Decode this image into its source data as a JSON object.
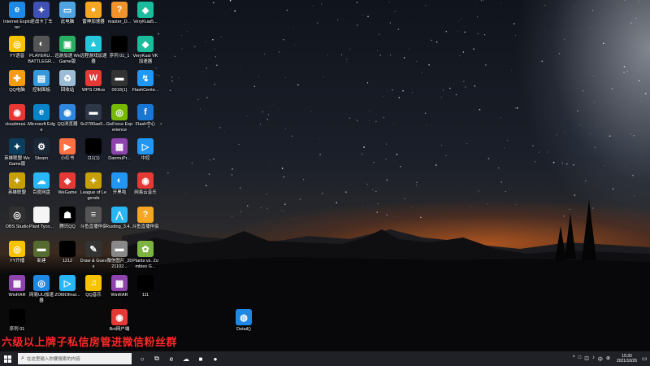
{
  "overlay_text": "六级以上牌子私信房管进微信粉丝群",
  "desktop_icons": [
    {
      "label": "Internet Explorer",
      "icon": "internet-explorer-icon",
      "color": "#1e88e5",
      "glyph": "e"
    },
    {
      "label": "逆战卡丁车",
      "icon": "game-icon",
      "color": "#3f51b5",
      "glyph": "✦"
    },
    {
      "label": "此电脑",
      "icon": "computer-icon",
      "color": "#4fa3e0",
      "glyph": "▭"
    },
    {
      "label": "雷神加速器",
      "icon": "accelerator-icon",
      "color": "#f5a623",
      "glyph": "●"
    },
    {
      "label": "master_D...",
      "icon": "app-icon",
      "color": "#f0932b",
      "glyph": "?"
    },
    {
      "label": "VeryKuai5...",
      "icon": "verykuai-icon",
      "color": "#1abc9c",
      "glyph": "◆"
    },
    {
      "label": "YY语音",
      "icon": "yy-icon",
      "color": "#f7c200",
      "glyph": "◎"
    },
    {
      "label": "PLAYERU... BATTLEGR...",
      "icon": "pubg-icon",
      "color": "#555",
      "glyph": "◐"
    },
    {
      "label": "迅游加速 WeGame版",
      "icon": "wegame-icon",
      "color": "#27ae60",
      "glyph": "▣"
    },
    {
      "label": "远程游戏加速器",
      "icon": "accelerator-icon",
      "color": "#26c6da",
      "glyph": "▲"
    },
    {
      "label": "序列 01_1",
      "icon": "video-file-icon",
      "color": "#000",
      "glyph": ""
    },
    {
      "label": "VeryKuai VK 加速器",
      "icon": "verykuai-icon",
      "color": "#1abc9c",
      "glyph": "◆"
    },
    {
      "label": "QQ电脑",
      "icon": "qq-icon",
      "color": "#f39c12",
      "glyph": "✚"
    },
    {
      "label": "控制面板",
      "icon": "control-panel-icon",
      "color": "#3498db",
      "glyph": "▤"
    },
    {
      "label": "回收站",
      "icon": "recycle-bin-icon",
      "color": "#9bbcd4",
      "glyph": "♻"
    },
    {
      "label": "WPS Office",
      "icon": "wps-icon",
      "color": "#e53935",
      "glyph": "W"
    },
    {
      "label": "0918(1)",
      "icon": "video-file-icon",
      "color": "#333",
      "glyph": "▬"
    },
    {
      "label": "FlashCente...",
      "icon": "flash-icon",
      "color": "#2196f3",
      "glyph": "↯"
    },
    {
      "label": "cloudmusi...",
      "icon": "netease-music-icon",
      "color": "#e53935",
      "glyph": "◉"
    },
    {
      "label": "Microsoft Edge",
      "icon": "edge-icon",
      "color": "#0a84c9",
      "glyph": "e"
    },
    {
      "label": "QQ浏览器",
      "icon": "qq-browser-icon",
      "color": "#2e86de",
      "glyph": "◉"
    },
    {
      "label": "6c2780ae5...",
      "icon": "image-file-icon",
      "color": "#2d3748",
      "glyph": "▬"
    },
    {
      "label": "GeForce Experience",
      "icon": "geforce-icon",
      "color": "#76b900",
      "glyph": "◎"
    },
    {
      "label": "Flash中心",
      "icon": "flash-icon",
      "color": "#1976d2",
      "glyph": "f"
    },
    {
      "label": "英雄联盟 WeGame版",
      "icon": "lol-icon",
      "color": "#0b3d5c",
      "glyph": "✦"
    },
    {
      "label": "Steam",
      "icon": "steam-icon",
      "color": "#1b2838",
      "glyph": "⚙"
    },
    {
      "label": "小红书",
      "icon": "app-icon",
      "color": "#ff7043",
      "glyph": "▶"
    },
    {
      "label": "111(1)",
      "icon": "video-file-icon",
      "color": "#000",
      "glyph": ""
    },
    {
      "label": "DanmuPr...",
      "icon": "winrar-icon",
      "color": "#8e44ad",
      "glyph": "▦"
    },
    {
      "label": "中控",
      "icon": "app-icon",
      "color": "#2196f3",
      "glyph": "▷"
    },
    {
      "label": "英雄联盟",
      "icon": "lol-icon",
      "color": "#c7a008",
      "glyph": "✦"
    },
    {
      "label": "百度网盘",
      "icon": "baidu-pan-icon",
      "color": "#29b6f6",
      "glyph": "☁"
    },
    {
      "label": "WeGame",
      "icon": "wegame-icon",
      "color": "#e53935",
      "glyph": "◈"
    },
    {
      "label": "League of Legends",
      "icon": "lol-icon",
      "color": "#c7a008",
      "glyph": "✦"
    },
    {
      "label": "开黑啦",
      "icon": "kaiheila-icon",
      "color": "#2196f3",
      "glyph": "◐"
    },
    {
      "label": "网易云音乐",
      "icon": "netease-music-icon",
      "color": "#e53935",
      "glyph": "◉"
    },
    {
      "label": "OBS Studio",
      "icon": "obs-icon",
      "color": "#303030",
      "glyph": "◎"
    },
    {
      "label": "Plant Tyco...",
      "icon": "document-icon",
      "color": "#f5f5f5",
      "glyph": ""
    },
    {
      "label": "腾讯QQ",
      "icon": "qq-penguin-icon",
      "color": "#000",
      "glyph": "☗"
    },
    {
      "label": "斗鱼直播伴侣",
      "icon": "douyu-icon",
      "color": "#555",
      "glyph": "≡"
    },
    {
      "label": "Rusting_3.4...",
      "icon": "app-icon",
      "color": "#29b6f6",
      "glyph": "⋀"
    },
    {
      "label": "斗鱼直播伴侣",
      "icon": "douyu-icon",
      "color": "#f5a623",
      "glyph": "?"
    },
    {
      "label": "YY开播",
      "icon": "yy-icon",
      "color": "#f7c200",
      "glyph": "◎"
    },
    {
      "label": "新建",
      "icon": "folder-icon",
      "color": "#556b2f",
      "glyph": "▬"
    },
    {
      "label": "1212",
      "icon": "document-icon",
      "color": "#000",
      "glyph": ""
    },
    {
      "label": "Draw & Guess",
      "icon": "draw-guess-icon",
      "color": "#333",
      "glyph": "✎"
    },
    {
      "label": "微信图片_2021102...",
      "icon": "image-file-icon",
      "color": "#888",
      "glyph": "▬"
    },
    {
      "label": "Plants vs. Zombies G...",
      "icon": "pvz-icon",
      "color": "#7cb342",
      "glyph": "✿"
    },
    {
      "label": "WinRAR",
      "icon": "winrar-icon",
      "color": "#8e44ad",
      "glyph": "▦"
    },
    {
      "label": "网易UU加速器",
      "icon": "uu-icon",
      "color": "#1e88e5",
      "glyph": "◎"
    },
    {
      "label": "ZOMOfinst...",
      "icon": "app-icon",
      "color": "#29b6f6",
      "glyph": "▷"
    },
    {
      "label": "QQ音乐",
      "icon": "qq-music-icon",
      "color": "#f7c200",
      "glyph": "♫"
    },
    {
      "label": "WinRAR",
      "icon": "winrar-icon",
      "color": "#8e44ad",
      "glyph": "▦"
    },
    {
      "label": "111",
      "icon": "video-file-icon",
      "color": "#000",
      "glyph": ""
    },
    {
      "label": "序列 01",
      "icon": "video-file-icon",
      "color": "#000",
      "glyph": ""
    },
    {
      "label": "Bot网户端",
      "icon": "app-icon",
      "color": "#e53935",
      "glyph": "◉"
    },
    {
      "label": "Detail()",
      "icon": "globe-icon",
      "color": "#1e88e5",
      "glyph": "◍"
    }
  ],
  "taskbar": {
    "search_placeholder": "在这里输入你要搜索的内容",
    "apps": [
      {
        "icon": "task-view-icon",
        "glyph": "○"
      },
      {
        "icon": "multitask-icon",
        "glyph": "⧉"
      },
      {
        "icon": "edge-icon",
        "glyph": "e"
      },
      {
        "icon": "wechat-icon",
        "glyph": "☁"
      },
      {
        "icon": "app-icon",
        "glyph": "■"
      },
      {
        "icon": "obs-icon",
        "glyph": "●"
      }
    ],
    "tray_icons": [
      "^",
      "□",
      "◫",
      "♪",
      "中",
      "⊕"
    ],
    "time": "15:30",
    "date": "2021/10/26"
  },
  "colors": {
    "taskbar_bg": "#1f2127",
    "overlay_text": "#ff2a2a"
  }
}
